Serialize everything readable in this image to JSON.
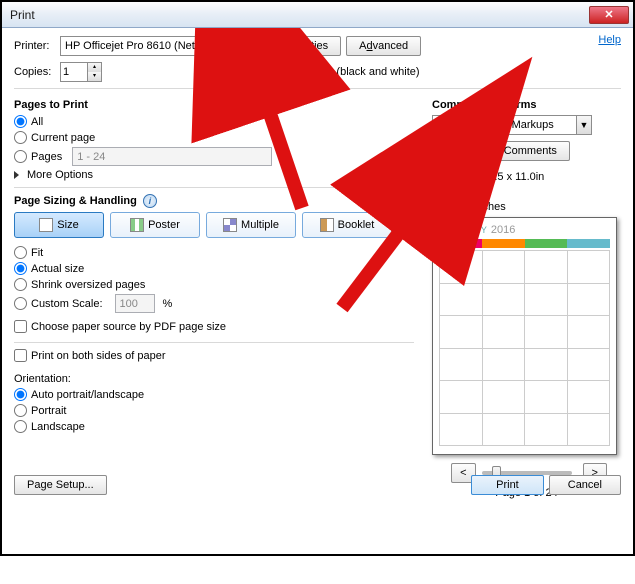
{
  "window": {
    "title": "Print"
  },
  "help": {
    "label": "Help"
  },
  "printer": {
    "label": "Printer:",
    "selected": "HP Officejet Pro 8610 (Network)",
    "propertiesBtn": "Properties",
    "advancedBtn": "Advanced"
  },
  "copies": {
    "label": "Copies:",
    "value": "1"
  },
  "grayscale": {
    "label": "Print in grayscale (black and white)"
  },
  "pagesToPrint": {
    "title": "Pages to Print",
    "all": "All",
    "current": "Current page",
    "pages": "Pages",
    "range": "1 - 24",
    "more": "More Options"
  },
  "sizing": {
    "title": "Page Sizing & Handling",
    "size": "Size",
    "poster": "Poster",
    "multiple": "Multiple",
    "booklet": "Booklet",
    "fit": "Fit",
    "actual": "Actual size",
    "shrink": "Shrink oversized pages",
    "customScale": "Custom Scale:",
    "scaleValue": "100",
    "percent": "%",
    "choosePaper": "Choose paper source by PDF page size"
  },
  "duplex": {
    "label": "Print on both sides of paper"
  },
  "orientation": {
    "title": "Orientation:",
    "auto": "Auto portrait/landscape",
    "portrait": "Portrait",
    "landscape": "Landscape"
  },
  "comments": {
    "title": "Comments & Forms",
    "selected": "Document and Markups",
    "summarize": "Summarize Comments"
  },
  "document": {
    "sizeLabel": "Document: 8.5 x 11.0in",
    "previewLabel": "8.5 x 11 Inches",
    "calMonth": "JANUARY",
    "calYear": "2016",
    "pageStatus": "Page 1 of 24"
  },
  "footer": {
    "pageSetup": "Page Setup...",
    "print": "Print",
    "cancel": "Cancel"
  }
}
